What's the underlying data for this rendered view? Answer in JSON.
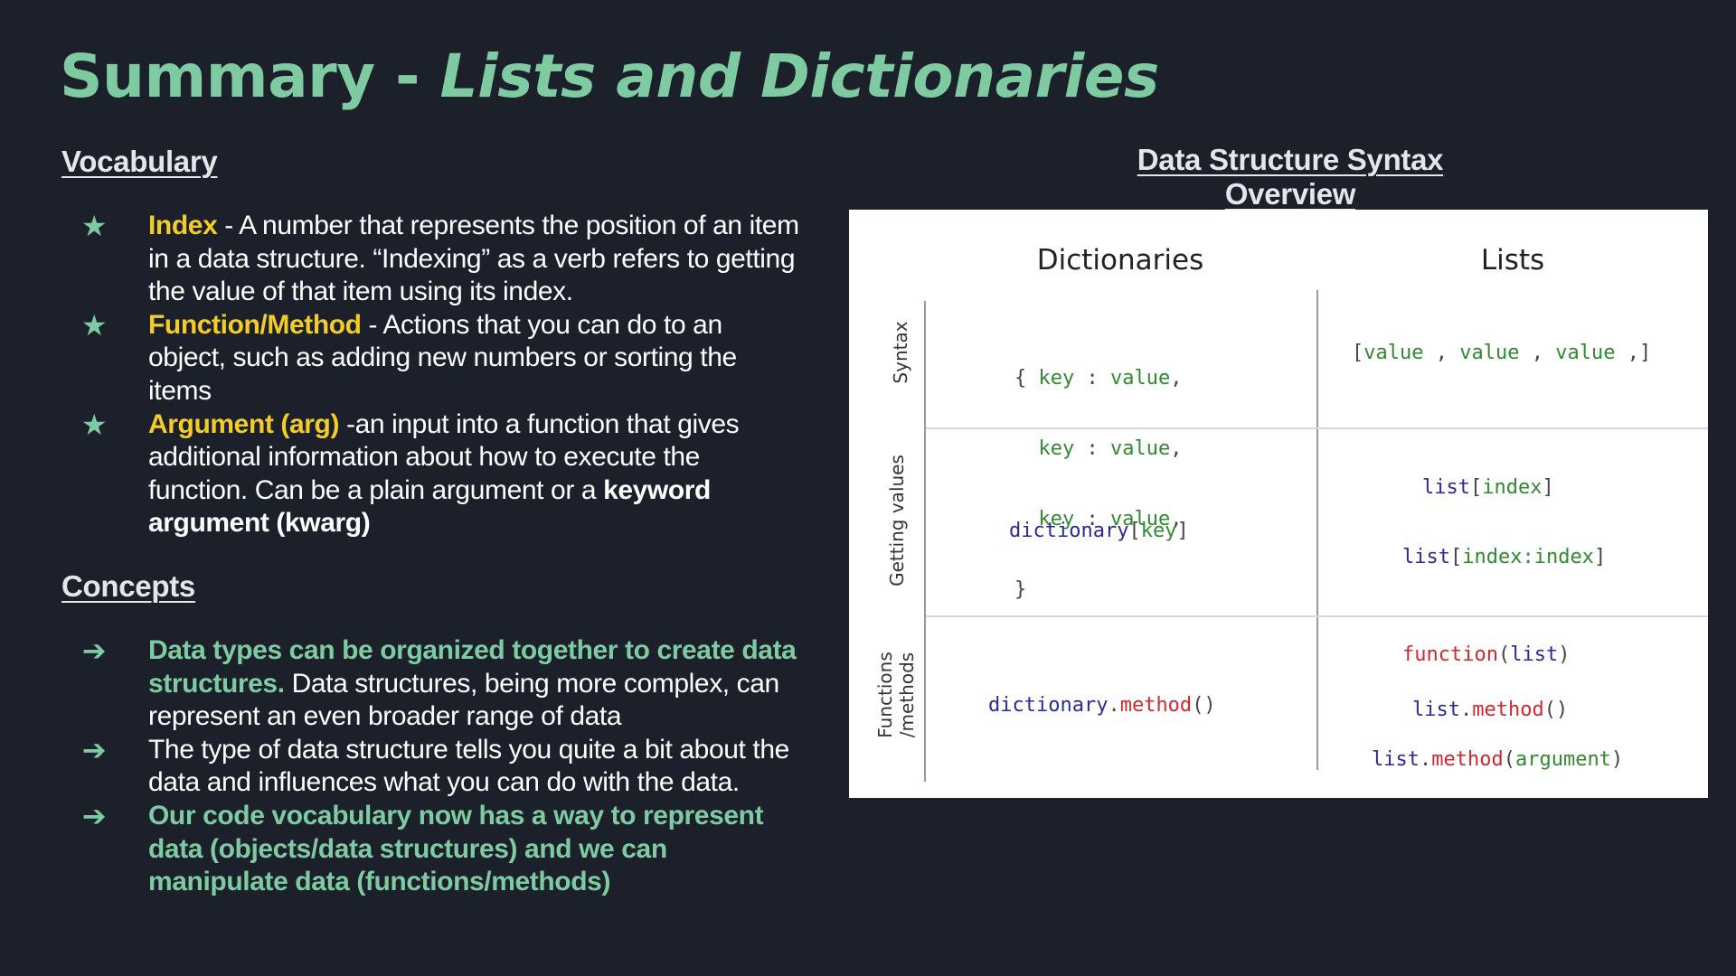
{
  "title": {
    "prefix": "Summary - ",
    "italic": "Lists and Dictionaries"
  },
  "colors": {
    "background": "#1b202b",
    "accent_green": "#7ecba1",
    "term_yellow": "#f4cc2a",
    "text": "#ffffff"
  },
  "vocabulary": {
    "heading": "Vocabulary",
    "marker_icon": "star-icon",
    "items": [
      {
        "term": "Index",
        "text": " - A number that represents the position of an item in a data structure.  “Indexing” as a verb refers to getting the value of that item using its index."
      },
      {
        "term": "Function/Method",
        "text": " - Actions that you can do to an object, such as adding new numbers or sorting the items"
      },
      {
        "term": "Argument (arg)",
        "text": " -an  input into a function that gives additional information about how to execute the function. Can be a plain argument or a ",
        "bold_tail": "keyword argument (kwarg)"
      }
    ]
  },
  "concepts": {
    "heading": "Concepts",
    "marker_icon": "arrow-right-icon",
    "items": [
      {
        "highlight": "Data types can be organized together to create data structures.",
        "text": "  Data structures, being more complex, can represent an even broader range of data"
      },
      {
        "highlight": "",
        "text": "The type of data structure tells you quite a bit about the data and influences what you can do with the data."
      },
      {
        "highlight": "Our code vocabulary now has a way to represent data (objects/data structures) and we can manipulate data (functions/methods)",
        "text": ""
      }
    ]
  },
  "overview": {
    "title": "Data Structure Syntax Overview",
    "columns": [
      "Dictionaries",
      "Lists"
    ],
    "rows": [
      "Syntax",
      "Getting values",
      "Functions /methods"
    ],
    "row_labels_lines": [
      [
        "Syntax"
      ],
      [
        "Getting values"
      ],
      [
        "Functions",
        "/methods"
      ]
    ],
    "cells": {
      "syntax_dict": {
        "open": "{",
        "lines": [
          {
            "key": "key",
            "sep": " : ",
            "value": "value",
            "end": ","
          },
          {
            "key": "key",
            "sep": " : ",
            "value": "value",
            "end": ","
          },
          {
            "key": "key",
            "sep": " : ",
            "value": "value",
            "end": ","
          }
        ],
        "close": "}"
      },
      "syntax_list": {
        "open": "[",
        "values": [
          "value",
          "value",
          "value"
        ],
        "sep": " , ",
        "close": " ,]"
      },
      "get_dict": {
        "obj": "dictionary",
        "open": "[",
        "arg": "key",
        "close": "]"
      },
      "get_list": [
        {
          "obj": "list",
          "open": "[",
          "arg": "index",
          "close": "]"
        },
        {
          "obj": "list",
          "open": "[",
          "arg": "index:index",
          "close": "]"
        }
      ],
      "func_dict": {
        "obj": "dictionary",
        "dot": ".",
        "method": "method",
        "parens": "()"
      },
      "func_list": [
        {
          "func": "function",
          "open": "(",
          "arg": "list",
          "close": ")"
        },
        {
          "obj": "list",
          "dot": ".",
          "method": "method",
          "parens": "()"
        },
        {
          "obj": "list",
          "dot": ".",
          "method": "method",
          "open": "(",
          "arg": "argument",
          "close": ")"
        }
      ]
    }
  }
}
